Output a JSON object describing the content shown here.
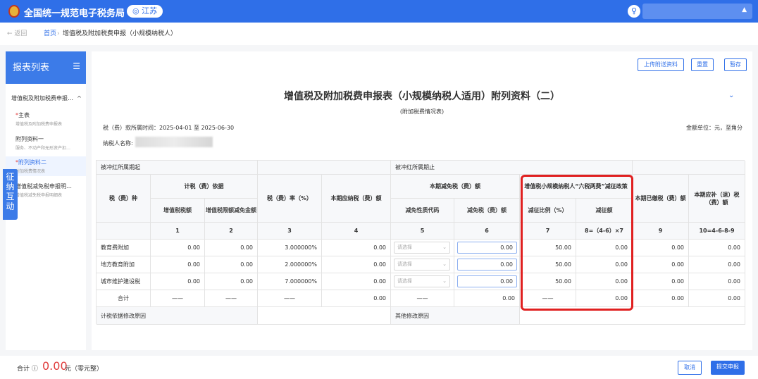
{
  "header": {
    "app_title": "全国统一规范电子税务局",
    "region": "◎ 江苏",
    "avatar_glyph": "♀",
    "user_caret": "▲"
  },
  "breadcrumb": {
    "back": "← 返回",
    "home": "首页",
    "sep": "›",
    "current": "增值税及附加税费申报（小规模纳税人）"
  },
  "sidebar": {
    "title": "报表列表",
    "menu_icon": "☰",
    "group": "增值税及附加税费申报…",
    "group_caret": "^",
    "items": [
      {
        "star": "*",
        "label": "主表",
        "sub": "增值税及附加税费申报表"
      },
      {
        "star": "",
        "label": "附列资料一",
        "sub": "服务、不动产和无形资产扣…"
      },
      {
        "star": "*",
        "label": "附列资料二",
        "sub": "附加税费情况表"
      },
      {
        "star": "",
        "label": "增值税减免税申报明…",
        "sub": "增值税减免税申报明细表"
      }
    ],
    "float_btn": "征纳互动"
  },
  "toolbar": {
    "upload": "上传附送资料",
    "reset": "重置",
    "save": "暂存"
  },
  "form": {
    "title": "增值税及附加税费申报表（小规模纳税人适用）附列资料（二）",
    "subtitle": "(附加税费情况表)",
    "period": "税（费）款所属时间：2025-04-01 至 2025-06-30",
    "unit": "金额单位：元，至角分",
    "taxpayer_label": "纳税人名称:",
    "collapse_icon": "⌄"
  },
  "table": {
    "top_left": "被冲红所属期起",
    "top_mid": "被冲红所属期止",
    "col_tax_type": "税（费）种",
    "grp_basis": "计税（费）依据",
    "col_vat": "增值税税额",
    "col_vat_credit": "增值税限额减免金额",
    "col_rate": "税（费）率（%）",
    "col_payable": "本期应纳税（费）额",
    "grp_relief": "本期减免税（费）额",
    "col_relief_code": "减免性质代码",
    "col_relief_amt": "减免税（费）额",
    "grp_six": "增值税小规模纳税人“六税两费”减征政策",
    "col_ratio": "减征比例（%）",
    "col_reduce": "减征额",
    "col_paid": "本期已缴税（费）额",
    "col_refund": "本期应补（退）税（费）额",
    "nums": [
      "1",
      "2",
      "3",
      "4",
      "5",
      "6",
      "7",
      "8=（4-6）×7",
      "9",
      "10=4-6-8-9"
    ],
    "rows": [
      {
        "name": "教育费附加",
        "vat": "0.00",
        "credit": "0.00",
        "rate": "3.000000%",
        "payable": "0.00",
        "code": "请选择",
        "relief": "0.00",
        "ratio": "50.00",
        "reduce": "0.00",
        "paid": "0.00",
        "refund": "0.00"
      },
      {
        "name": "地方教育附加",
        "vat": "0.00",
        "credit": "0.00",
        "rate": "2.000000%",
        "payable": "0.00",
        "code": "请选择",
        "relief": "0.00",
        "ratio": "50.00",
        "reduce": "0.00",
        "paid": "0.00",
        "refund": "0.00"
      },
      {
        "name": "城市维护建设税",
        "vat": "0.00",
        "credit": "0.00",
        "rate": "7.000000%",
        "payable": "0.00",
        "code": "请选择",
        "relief": "0.00",
        "ratio": "50.00",
        "reduce": "0.00",
        "paid": "0.00",
        "refund": "0.00"
      }
    ],
    "total": {
      "name": "合计",
      "dash": "——",
      "payable": "0.00",
      "relief": "0.00",
      "reduce": "0.00",
      "paid": "0.00",
      "refund": "0.00"
    },
    "basis_reason": "计税依据修改原因",
    "other_reason": "其他修改原因"
  },
  "footer": {
    "total_label": "合计 ⓘ",
    "total_value": "0.00",
    "total_unit": "元（零元整）",
    "cancel": "取消",
    "submit": "提交申报"
  },
  "colors": {
    "primary": "#2f6fe8",
    "highlight_border": "#e02020",
    "amount_red": "#e03c3c"
  }
}
